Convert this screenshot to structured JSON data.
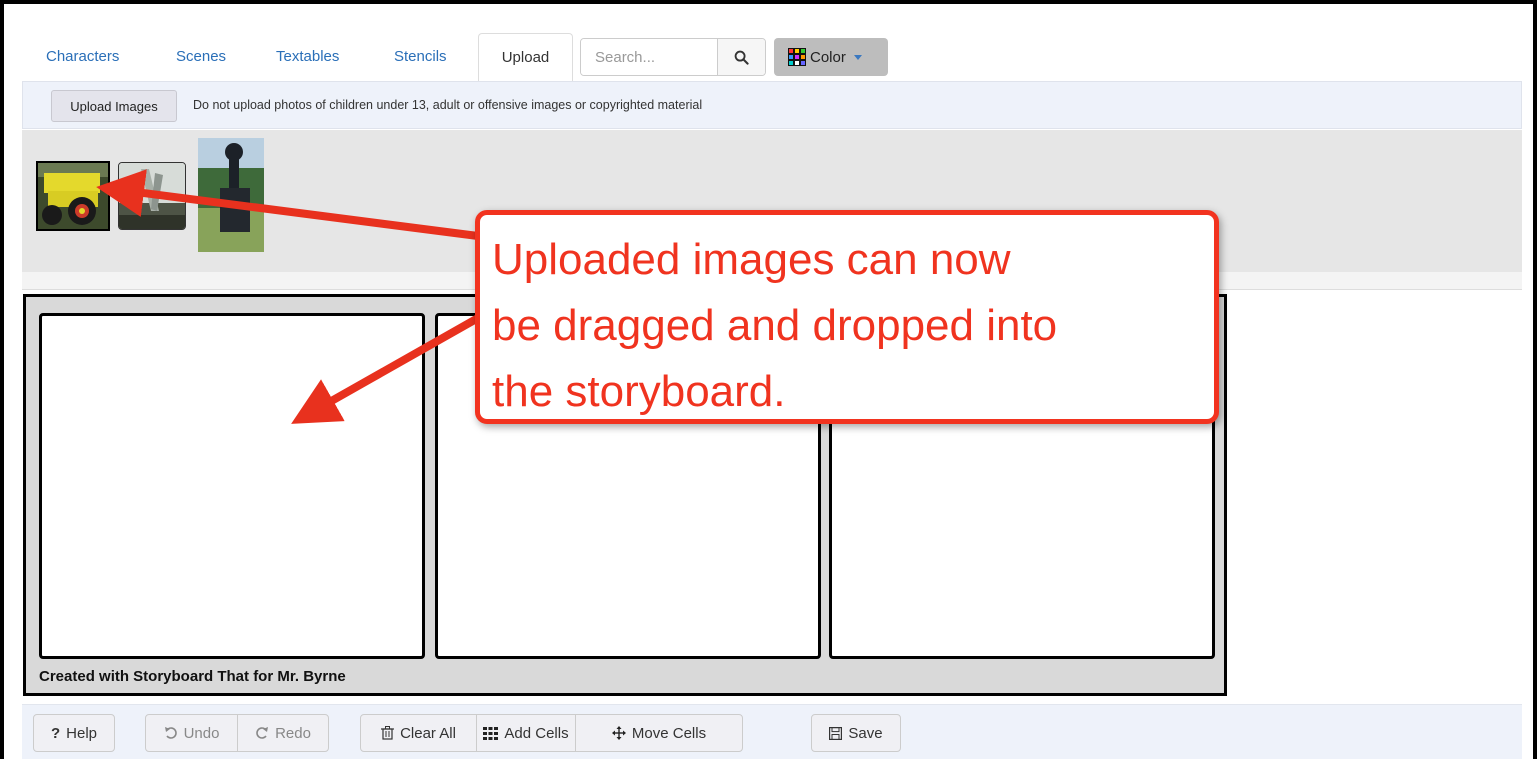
{
  "tabs": [
    {
      "label": "Characters",
      "active": false
    },
    {
      "label": "Scenes",
      "active": false
    },
    {
      "label": "Textables",
      "active": false
    },
    {
      "label": "Stencils",
      "active": false
    },
    {
      "label": "Upload",
      "active": true
    }
  ],
  "search": {
    "placeholder": "Search...",
    "icon": "search-icon"
  },
  "color_button": {
    "label": "Color",
    "icon": "color-grid-icon"
  },
  "upload_bar": {
    "button_label": "Upload Images",
    "note": "Do not upload photos of children under 13, adult or offensive images or copyrighted material"
  },
  "uploaded_images": [
    {
      "subject": "yellow truck",
      "selected": true
    },
    {
      "subject": "sculpture",
      "selected": false
    },
    {
      "subject": "monument",
      "selected": false
    }
  ],
  "storyboard": {
    "cells": 3,
    "credit": "Created with Storyboard That for Mr. Byrne"
  },
  "callout": {
    "lines": [
      "Uploaded images can now",
      "be dragged and dropped into",
      "the storyboard."
    ],
    "color": "#f0331f"
  },
  "toolbar": {
    "help": "Help",
    "undo": "Undo",
    "redo": "Redo",
    "clear_all": "Clear All",
    "add_cells": "Add Cells",
    "move_cells": "Move Cells",
    "save": "Save"
  },
  "colors": {
    "link": "#2a6fb8",
    "accent_red": "#f2331f",
    "panel": "#eef2fa"
  }
}
